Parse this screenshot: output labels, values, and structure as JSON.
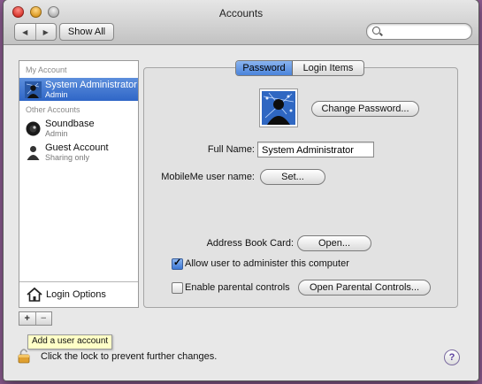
{
  "window": {
    "title": "Accounts"
  },
  "toolbar": {
    "back_label": "◀",
    "forward_label": "▶",
    "show_all_label": "Show All",
    "search_value": "",
    "search_placeholder": ""
  },
  "sidebar": {
    "my_account_label": "My Account",
    "other_accounts_label": "Other Accounts",
    "accounts": [
      {
        "name": "System Administrator",
        "role": "Admin",
        "selected": true,
        "icon": "admin-user-icon"
      },
      {
        "name": "Soundbase",
        "role": "Admin",
        "selected": false,
        "icon": "soundbase-icon"
      },
      {
        "name": "Guest Account",
        "role": "Sharing only",
        "selected": false,
        "icon": "guest-user-icon"
      }
    ],
    "login_options_label": "Login Options",
    "add_label": "+",
    "remove_label": "−"
  },
  "tooltip": {
    "text": "Add a user account"
  },
  "tabs": {
    "password_label": "Password",
    "login_items_label": "Login Items"
  },
  "detail": {
    "change_password_label": "Change Password...",
    "full_name_label": "Full Name:",
    "full_name_value": "System Administrator",
    "mobileme_label": "MobileMe user name:",
    "set_label": "Set...",
    "address_book_label": "Address Book Card:",
    "open_label": "Open...",
    "allow_admin_label": "Allow user to administer this computer",
    "allow_admin_checked": true,
    "parental_label": "Enable parental controls",
    "parental_checked": false,
    "open_parental_label": "Open Parental Controls..."
  },
  "footer": {
    "lock_text": "Click the lock to prevent further changes.",
    "help_label": "?"
  }
}
